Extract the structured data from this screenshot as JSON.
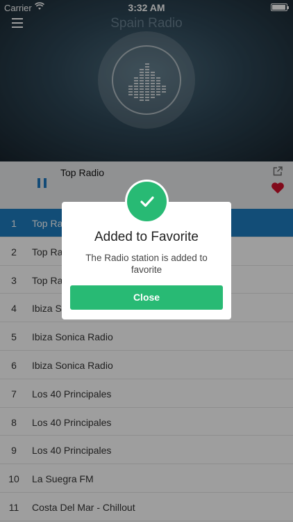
{
  "status_bar": {
    "carrier": "Carrier",
    "time": "3:32 AM"
  },
  "header": {
    "title": "Spain Radio"
  },
  "now_playing": {
    "title": "Top Radio"
  },
  "stations": [
    {
      "num": "1",
      "name": "Top Radio",
      "active": true
    },
    {
      "num": "2",
      "name": "Top Radio"
    },
    {
      "num": "3",
      "name": "Top Radio"
    },
    {
      "num": "4",
      "name": "Ibiza Sonica Radio"
    },
    {
      "num": "5",
      "name": "Ibiza Sonica Radio"
    },
    {
      "num": "6",
      "name": "Ibiza Sonica Radio"
    },
    {
      "num": "7",
      "name": "Los 40 Principales"
    },
    {
      "num": "8",
      "name": "Los 40 Principales"
    },
    {
      "num": "9",
      "name": "Los 40 Principales"
    },
    {
      "num": "10",
      "name": "La Suegra FM"
    },
    {
      "num": "11",
      "name": "Costa Del Mar - Chillout"
    }
  ],
  "dialog": {
    "title": "Added to Favorite",
    "message": "The Radio station is added to favorite",
    "close_label": "Close"
  },
  "colors": {
    "accent": "#1e7dc0",
    "success": "#28ba74",
    "favorite": "#d0102b"
  }
}
